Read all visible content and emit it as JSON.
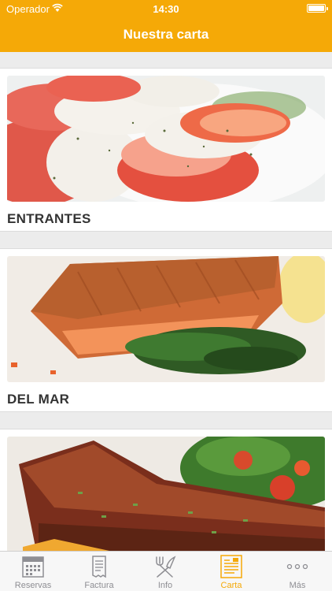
{
  "status_bar": {
    "carrier": "Operador",
    "time": "14:30",
    "battery_level": 1.0
  },
  "nav": {
    "title": "Nuestra carta"
  },
  "categories": [
    {
      "label": "ENTRANTES",
      "image": "caprese-salad"
    },
    {
      "label": "DEL MAR",
      "image": "grilled-salmon"
    },
    {
      "label": "",
      "image": "grilled-steak"
    }
  ],
  "tabs": [
    {
      "label": "Reservas",
      "icon": "calendar-icon",
      "active": false
    },
    {
      "label": "Factura",
      "icon": "receipt-icon",
      "active": false
    },
    {
      "label": "Info",
      "icon": "fork-knife-icon",
      "active": false
    },
    {
      "label": "Carta",
      "icon": "menu-icon",
      "active": true
    },
    {
      "label": "Más",
      "icon": "more-icon",
      "active": false
    }
  ],
  "colors": {
    "brand": "#f5a907",
    "inactive": "#8e8e93"
  }
}
